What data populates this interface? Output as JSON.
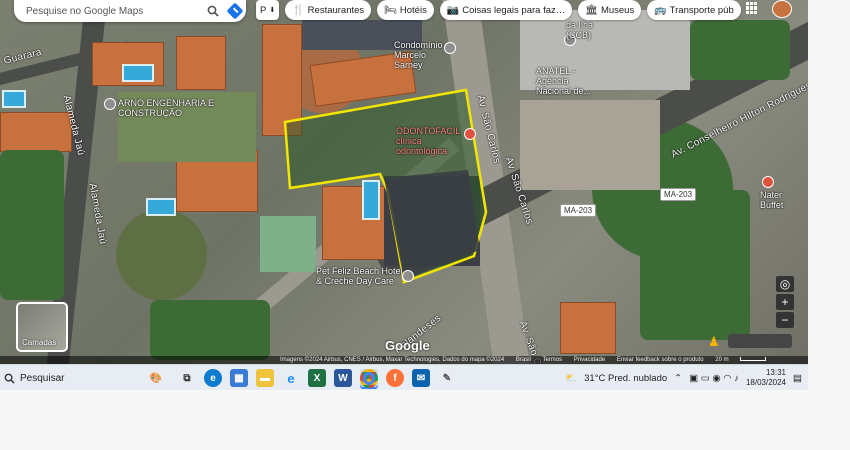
{
  "map": {
    "search_placeholder": "Pesquise no Google Maps",
    "chips": [
      {
        "label": "Restaurantes",
        "icon": "fork-knife-icon",
        "glyph": "🍴"
      },
      {
        "label": "Hotéis",
        "icon": "bed-icon",
        "glyph": "🛏"
      },
      {
        "label": "Coisas legais para faz…",
        "icon": "camera-icon",
        "glyph": "📷"
      },
      {
        "label": "Museus",
        "icon": "museum-icon",
        "glyph": "🏛"
      },
      {
        "label": "Transporte púb",
        "icon": "bus-icon",
        "glyph": "🚌"
      }
    ],
    "street_labels": {
      "guarara": "Guarara",
      "alameda_jau_1": "Alameda Jaú",
      "alameda_jau_2": "Alameda Jaú",
      "av_sao_carlos_1": "Av. São Carlos",
      "av_sao_carlos_2": "Av. São Carlos",
      "av_sao_carlos_3": "Av. São C",
      "av_conselheiro": "Av. Conselheiro Hilton Rodrigues",
      "holandeses": "Holandeses"
    },
    "poi_labels": {
      "arno": "ARNO ENGENHARIA E CONSTRUÇÃO",
      "condominio": "Condomínio Marcelo Sarney",
      "odontofacil": "ODONTOFACIL clínica odontológica",
      "anatel": "ANATEL - Agência Nacional de...",
      "da_ilha": "da Ilha (CCB)",
      "pet_feliz": "Pet Feliz Beach Hotel & Creche Day Care",
      "nater": "Nater Buffet"
    },
    "road_shields": [
      "MA-203",
      "MA-203"
    ],
    "layers_label": "Camadas",
    "google_logo": "Google",
    "attribution": "Imagens ©2024 Airbus, CNES / Airbus, Maxar Technologies, Dados do mapa ©2024",
    "attribution_links": [
      "Brasil",
      "Termos",
      "Privacidade",
      "Enviar feedback sobre o produto"
    ],
    "scale_label": "20 m"
  },
  "taskbar": {
    "search_label": "Pesquisar",
    "apps": [
      "task-view",
      "edge",
      "store",
      "explorer",
      "ie",
      "excel",
      "word",
      "chrome",
      "firefox",
      "mail",
      "paint"
    ],
    "weather": "31°C  Pred. nublado",
    "time": "13:31",
    "date": "18/03/2024"
  },
  "colors": {
    "highlight": "#f2e600",
    "map_blue": "#1a73e8"
  }
}
